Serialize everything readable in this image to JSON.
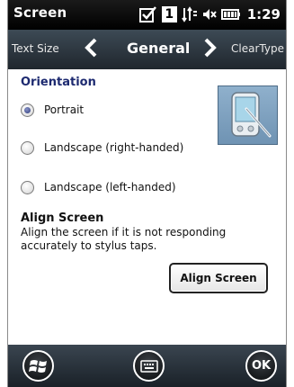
{
  "status_bar": {
    "title": "Screen",
    "battery_badge": "1",
    "time": "1:29",
    "icons": [
      "checkbox-icon",
      "badge-1-icon",
      "connectivity-icon",
      "speaker-icon",
      "battery-icon"
    ]
  },
  "tab_nav": {
    "prev_label": "Text Size",
    "current_label": "General",
    "next_label": "ClearType"
  },
  "orientation": {
    "heading": "Orientation",
    "options": [
      {
        "label": "Portrait",
        "selected": true
      },
      {
        "label": "Landscape (right-handed)",
        "selected": false
      },
      {
        "label": "Landscape (left-handed)",
        "selected": false
      }
    ]
  },
  "align_screen": {
    "heading": "Align Screen",
    "description": "Align the screen if it is not responding accurately to stylus taps.",
    "button_label": "Align Screen"
  },
  "bottom_bar": {
    "ok_label": "OK"
  },
  "colors": {
    "heading": "#1d2a70",
    "status_bar": "#000000",
    "tab_bar": "#2f3a44"
  }
}
